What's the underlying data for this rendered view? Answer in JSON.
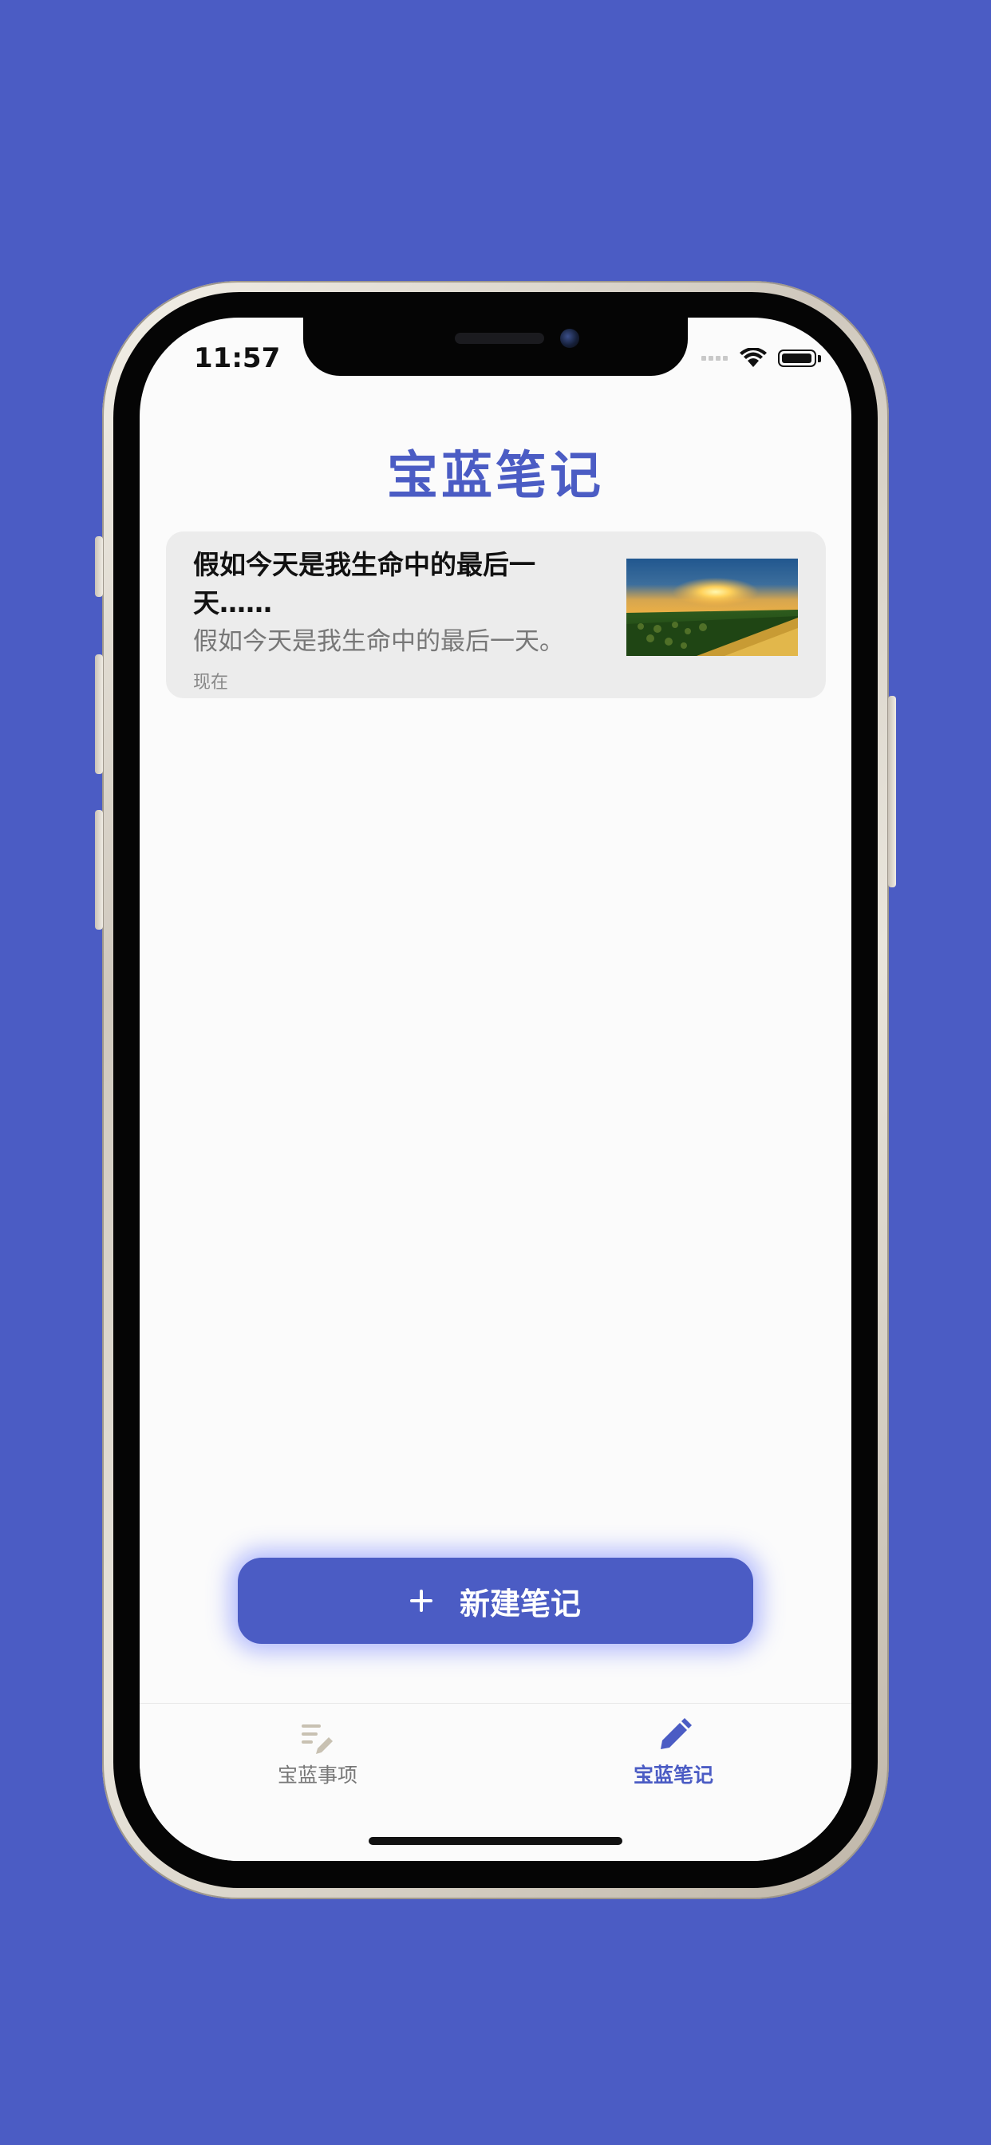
{
  "status_bar": {
    "time": "11:57"
  },
  "header": {
    "title": "宝蓝笔记"
  },
  "notes": [
    {
      "title": "假如今天是我生命中的最后一天……",
      "preview": "假如今天是我生命中的最后一天。",
      "time": "现在",
      "thumbnail_icon": "sunset-field-image"
    }
  ],
  "actions": {
    "new_note_label": "新建笔记",
    "new_note_icon": "plus-icon"
  },
  "tab_bar": {
    "items": [
      {
        "label": "宝蓝事项",
        "icon": "edit-note-icon",
        "active": false
      },
      {
        "label": "宝蓝笔记",
        "icon": "pencil-icon",
        "active": true
      }
    ]
  },
  "colors": {
    "accent": "#4b5cc4",
    "background": "#4b5cc4",
    "screen": "#fbfbfb",
    "card": "#ececec",
    "muted_text": "#777777"
  }
}
